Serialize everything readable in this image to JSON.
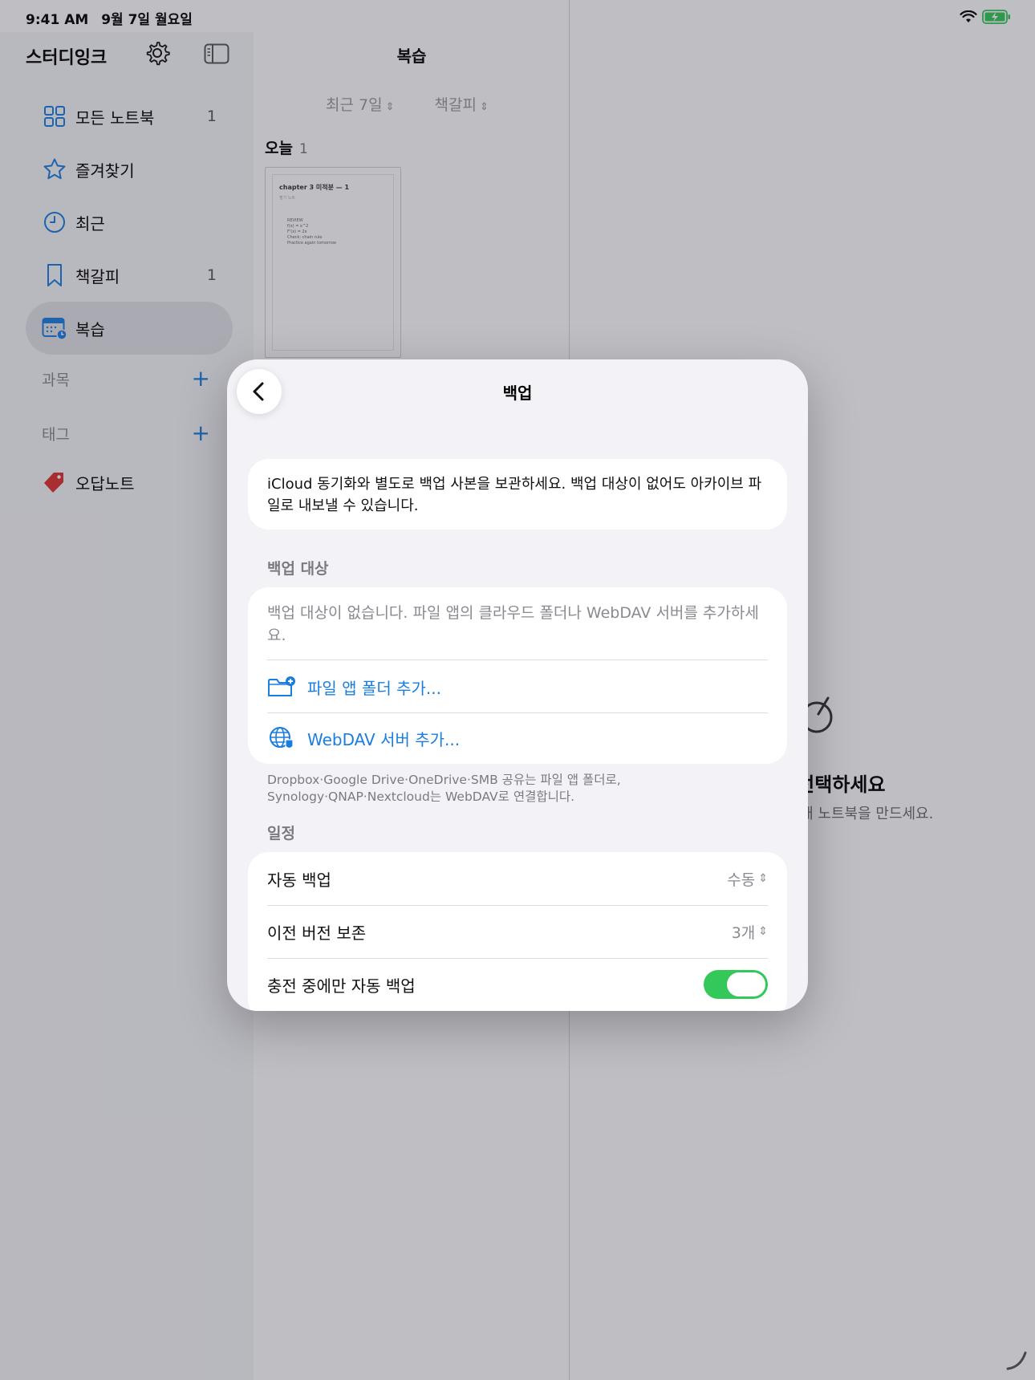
{
  "status": {
    "time": "9:41 AM",
    "date": "9월 7일 월요일"
  },
  "sidebar": {
    "app_title": "스터디잉크",
    "items": [
      {
        "label": "모든 노트북",
        "count": "1",
        "icon": "grid-icon"
      },
      {
        "label": "즐겨찾기",
        "count": "",
        "icon": "star-icon"
      },
      {
        "label": "최근",
        "count": "",
        "icon": "clock-icon"
      },
      {
        "label": "책갈피",
        "count": "1",
        "icon": "bookmark-icon"
      },
      {
        "label": "복습",
        "count": "",
        "icon": "calendar-icon",
        "active": true
      }
    ],
    "sections": {
      "subjects": "과목",
      "tags": "태그"
    },
    "tag_items": [
      {
        "label": "오답노트",
        "color": "#e0312f"
      }
    ]
  },
  "middle": {
    "title": "복습",
    "filter_period": "최근 7일",
    "filter_type": "책갈피",
    "today_label": "오늘",
    "today_count": "1",
    "thumbnail": {
      "title": "chapter 3 미적분 — 1",
      "subtitle": "필기 노트",
      "lines": [
        "REVIEW",
        "f(x) = x^2",
        "F'(x) = 2x",
        "Check: chain rule",
        "Practice again tomorrow"
      ]
    }
  },
  "detail": {
    "empty_title": "노트북을 선택하세요",
    "empty_sub": "노트북을 선택하거나 새 노트북을 만드세요."
  },
  "modal": {
    "title": "백업",
    "intro": "iCloud 동기화와 별도로 백업 사본을 보관하세요. 백업 대상이 없어도 아카이브 파일로 내보낼 수 있습니다.",
    "targets_header": "백업 대상",
    "targets_empty": "백업 대상이 없습니다. 파일 앱의 클라우드 폴더나 WebDAV 서버를 추가하세요.",
    "add_folder": "파일 앱 폴더 추가...",
    "add_webdav": "WebDAV 서버 추가...",
    "footnote": "Dropbox·Google Drive·OneDrive·SMB 공유는 파일 앱 폴더로, Synology·QNAP·Nextcloud는 WebDAV로 연결합니다.",
    "schedule_header": "일정",
    "auto_backup_label": "자동 백업",
    "auto_backup_value": "수동",
    "keep_versions_label": "이전 버전 보존",
    "keep_versions_value": "3개",
    "charging_only_label": "충전 중에만 자동 백업",
    "charging_only_on": true
  },
  "colors": {
    "accent": "#1a7de0",
    "toggle_on": "#34c759",
    "battery": "#34c759"
  }
}
